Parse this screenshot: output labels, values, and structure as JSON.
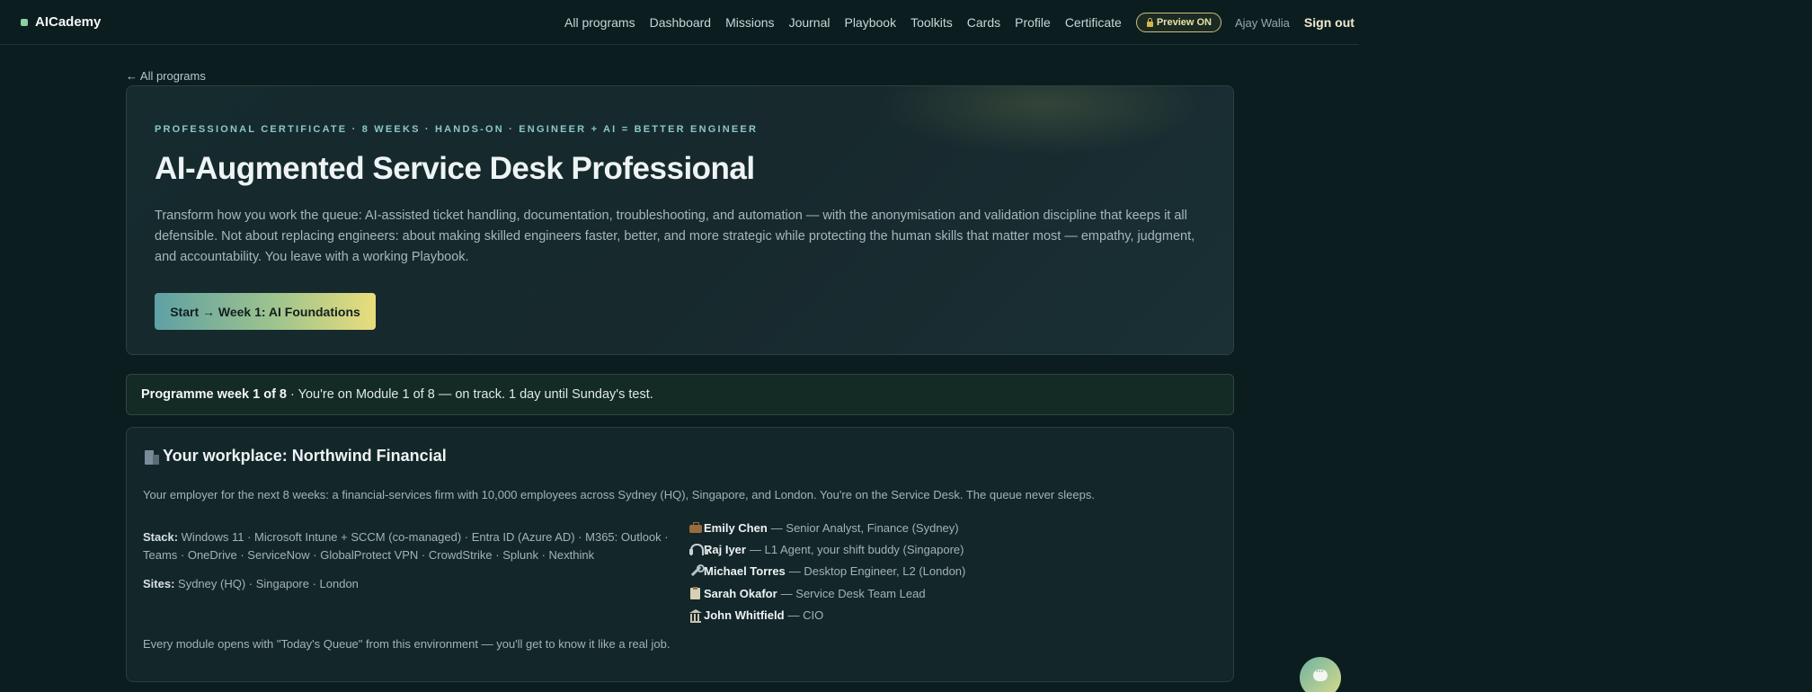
{
  "brand": {
    "name": "AICademy"
  },
  "nav": {
    "items": [
      "All programs",
      "Dashboard",
      "Missions",
      "Journal",
      "Playbook",
      "Toolkits",
      "Cards",
      "Profile",
      "Certificate"
    ],
    "preview_label": "Preview ON",
    "user_name": "Ajay Walia",
    "sign_out": "Sign out"
  },
  "back_link": "← All programs",
  "hero": {
    "kicker": "PROFESSIONAL CERTIFICATE · 8 WEEKS · HANDS-ON · ENGINEER + AI = BETTER ENGINEER",
    "title": "AI-Augmented Service Desk Professional",
    "description": "Transform how you work the queue: AI-assisted ticket handling, documentation, troubleshooting, and automation — with the anonymisation and validation discipline that keeps it all defensible. Not about replacing engineers: about making skilled engineers faster, better, and more strategic while protecting the human skills that matter most — empathy, judgment, and accountability. You leave with a working Playbook.",
    "cta_label": "Start → Week 1: AI Foundations"
  },
  "progress": {
    "week_label": "Programme week 1 of 8",
    "status_text": " · You're on Module 1 of 8 — on track. 1 day until Sunday's test."
  },
  "workplace": {
    "title": "Your workplace: Northwind Financial",
    "intro": "Your employer for the next 8 weeks: a financial-services firm with 10,000 employees across Sydney (HQ), Singapore, and London. You're on the Service Desk. The queue never sleeps.",
    "stack_label": "Stack:",
    "stack_value": "Windows 11 · Microsoft Intune + SCCM (co-managed) · Entra ID (Azure AD) · M365: Outlook · Teams · OneDrive · ServiceNow · GlobalProtect VPN · CrowdStrike · Splunk · Nexthink",
    "sites_label": "Sites:",
    "sites_value": "Sydney (HQ) · Singapore · London",
    "people": [
      {
        "icon": "briefcase-icon",
        "name": "Emily Chen",
        "role": "— Senior Analyst, Finance (Sydney)"
      },
      {
        "icon": "headset-icon",
        "name": "Raj Iyer",
        "role": "— L1 Agent, your shift buddy (Singapore)"
      },
      {
        "icon": "wrench-icon",
        "name": "Michael Torres",
        "role": "— Desktop Engineer, L2 (London)"
      },
      {
        "icon": "clipboard-icon",
        "name": "Sarah Okafor",
        "role": "— Service Desk Team Lead"
      },
      {
        "icon": "bank-icon",
        "name": "John Whitfield",
        "role": "— CIO"
      }
    ],
    "footer_note": "Every module opens with \"Today's Queue\" from this environment — you'll get to know it like a real job."
  },
  "colors": {
    "background": "#0c1d1f",
    "accent_teal": "#8cc7c9",
    "accent_gold": "#e9dd7c"
  }
}
